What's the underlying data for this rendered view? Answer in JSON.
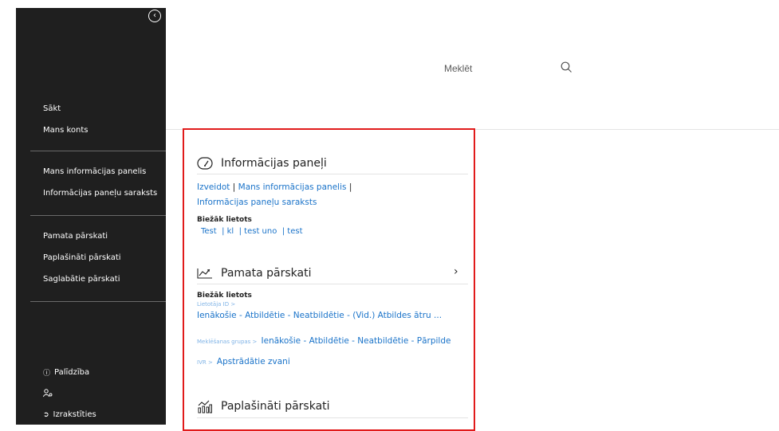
{
  "sidebar": {
    "nav": [
      "Sākt",
      "Mans konts"
    ],
    "dash": [
      "Mans informācijas panelis",
      "Informācijas paneļu saraksts"
    ],
    "reports": [
      "Pamata pārskati",
      "Paplašināti pārskati",
      "Saglabātie pārskati"
    ],
    "help": "Palīdzība",
    "logout": "Izrakstīties"
  },
  "search": {
    "label": "Meklēt"
  },
  "dashboards": {
    "title": "Informācijas paneļi",
    "create": "Izveidot",
    "my": "Mans informācijas panelis",
    "list": "Informācijas paneļu saraksts",
    "frequent_label": "Biežāk lietots",
    "frequent": [
      "Test",
      "kl",
      "test uno",
      "test"
    ]
  },
  "basic": {
    "title": "Pamata pārskati",
    "frequent_label": "Biežāk lietots",
    "items": [
      {
        "prefix": "Lietotāja ID >",
        "text": "Ienākošie - Atbildētie - Neatbildētie - (Vid.) Atbildes ātru ..."
      },
      {
        "prefix": "Meklēšanas grupas >",
        "text": "Ienākošie - Atbildētie - Neatbildētie - Pārpilde"
      },
      {
        "prefix": "IVR >",
        "text": "Apstrādātie zvani"
      }
    ]
  },
  "advanced": {
    "title": "Paplašināti pārskati"
  },
  "colors": {
    "accent": "#1a73c9",
    "sidebar": "#1f1f1f",
    "highlight": "#e11b1b"
  }
}
